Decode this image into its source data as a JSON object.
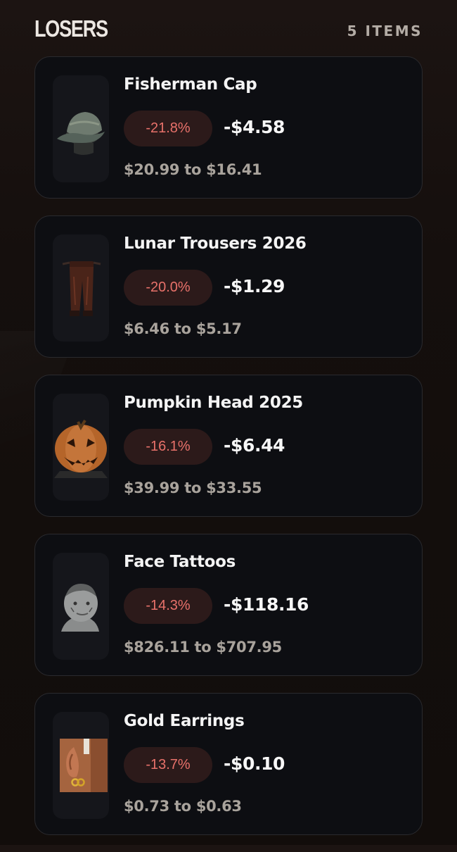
{
  "header": {
    "title": "LOSERS",
    "count_label": "5 ITEMS"
  },
  "colors": {
    "negative_text": "#e8716a",
    "negative_badge_bg": "#2c1a1a",
    "card_bg": "#0d0e12",
    "muted_text": "#a9a39c"
  },
  "items": [
    {
      "name": "Fisherman Cap",
      "percent": "-21.8%",
      "change": "-$4.58",
      "range": "$20.99 to $16.41",
      "icon": "fisherman-cap-icon"
    },
    {
      "name": "Lunar Trousers 2026",
      "percent": "-20.0%",
      "change": "-$1.29",
      "range": "$6.46 to $5.17",
      "icon": "trousers-icon"
    },
    {
      "name": "Pumpkin Head 2025",
      "percent": "-16.1%",
      "change": "-$6.44",
      "range": "$39.99 to $33.55",
      "icon": "pumpkin-head-icon"
    },
    {
      "name": "Face Tattoos",
      "percent": "-14.3%",
      "change": "-$118.16",
      "range": "$826.11 to $707.95",
      "icon": "face-tattoos-icon"
    },
    {
      "name": "Gold Earrings",
      "percent": "-13.7%",
      "change": "-$0.10",
      "range": "$0.73 to $0.63",
      "icon": "gold-earrings-icon"
    }
  ]
}
